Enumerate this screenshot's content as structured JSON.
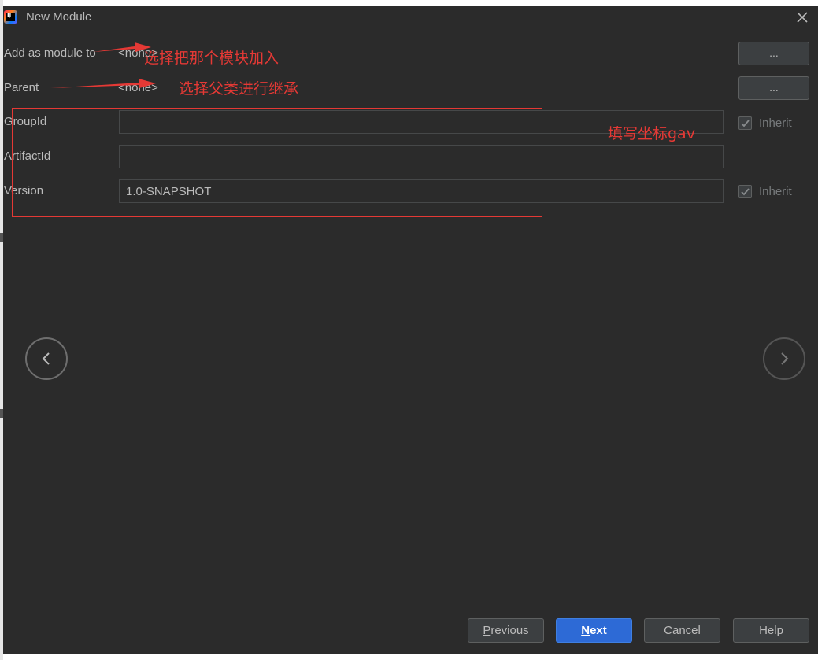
{
  "window": {
    "title": "New Module",
    "app_icon_text": "IJ"
  },
  "form": {
    "add_as_module_label": "Add as module to",
    "add_as_module_value": "<none>",
    "parent_label": "Parent",
    "parent_value": "<none>",
    "browse_label": "...",
    "group_id_label": "GroupId",
    "group_id_value": "",
    "artifact_id_label": "ArtifactId",
    "artifact_id_value": "",
    "version_label": "Version",
    "version_value": "1.0-SNAPSHOT",
    "inherit_label": "Inherit"
  },
  "annotations": {
    "module": "选择把那个模块加入",
    "parent": "选择父类进行继承",
    "gav": "填写坐标gav",
    "color": "#e53935"
  },
  "footer": {
    "previous": "Previous",
    "next": "Next",
    "cancel": "Cancel",
    "help": "Help"
  },
  "icons": {
    "close": "close-icon",
    "prev_arrow": "chevron-left-icon",
    "next_arrow": "chevron-right-icon",
    "check": "checkmark-icon"
  },
  "colors": {
    "background": "#2b2b2b",
    "primary_button": "#2d6ad6",
    "text": "#bbbbbb"
  }
}
